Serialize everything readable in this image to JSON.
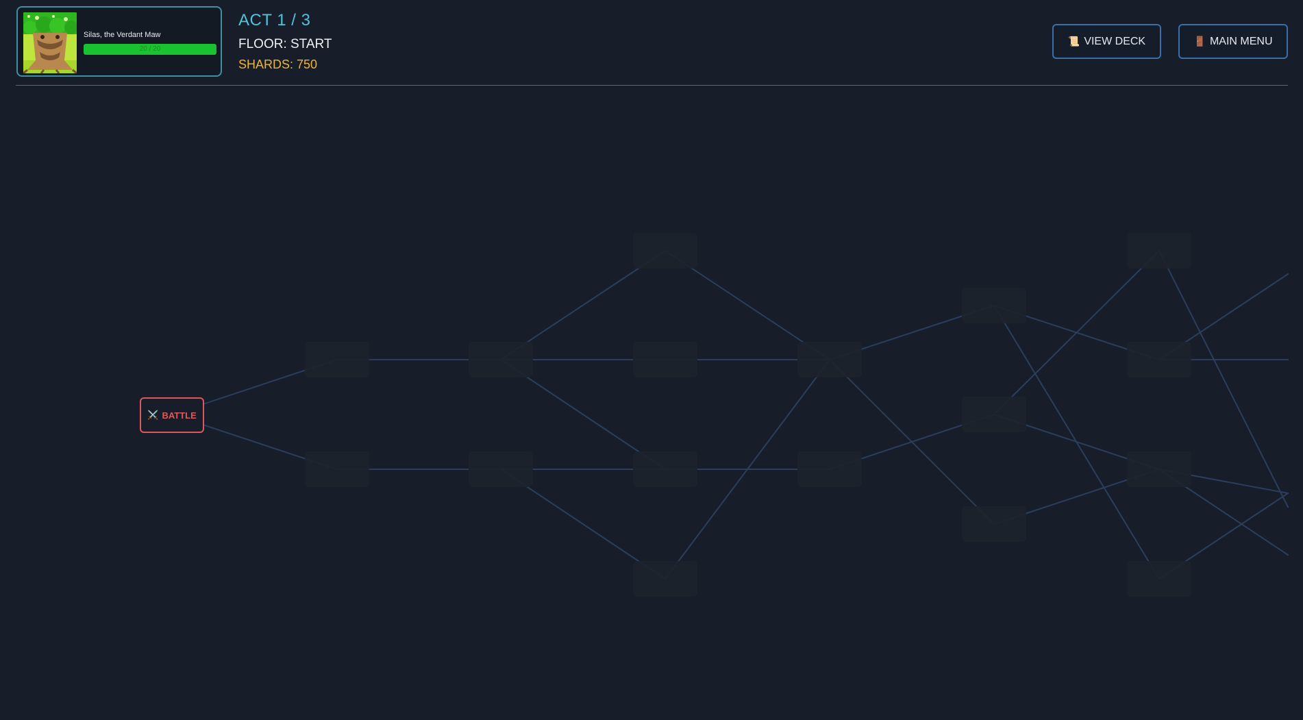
{
  "header": {
    "hero": {
      "name": "Silas, the Verdant Maw",
      "hp_text": "20 / 20",
      "hp_fraction": 1.0,
      "hp_color": "#19c32f"
    },
    "act": "ACT 1 / 3",
    "floor": "FLOOR: START",
    "shards": "SHARDS: 750",
    "buttons": {
      "view_deck": {
        "label": "VIEW DECK",
        "icon": "scroll-icon"
      },
      "main_menu": {
        "label": "MAIN MENU",
        "icon": "door-icon"
      }
    }
  },
  "map": {
    "start": {
      "label": "BATTLE",
      "icon": "crossed-swords-icon",
      "color": "#e0575b"
    },
    "path_color": "#2b3e5c"
  }
}
